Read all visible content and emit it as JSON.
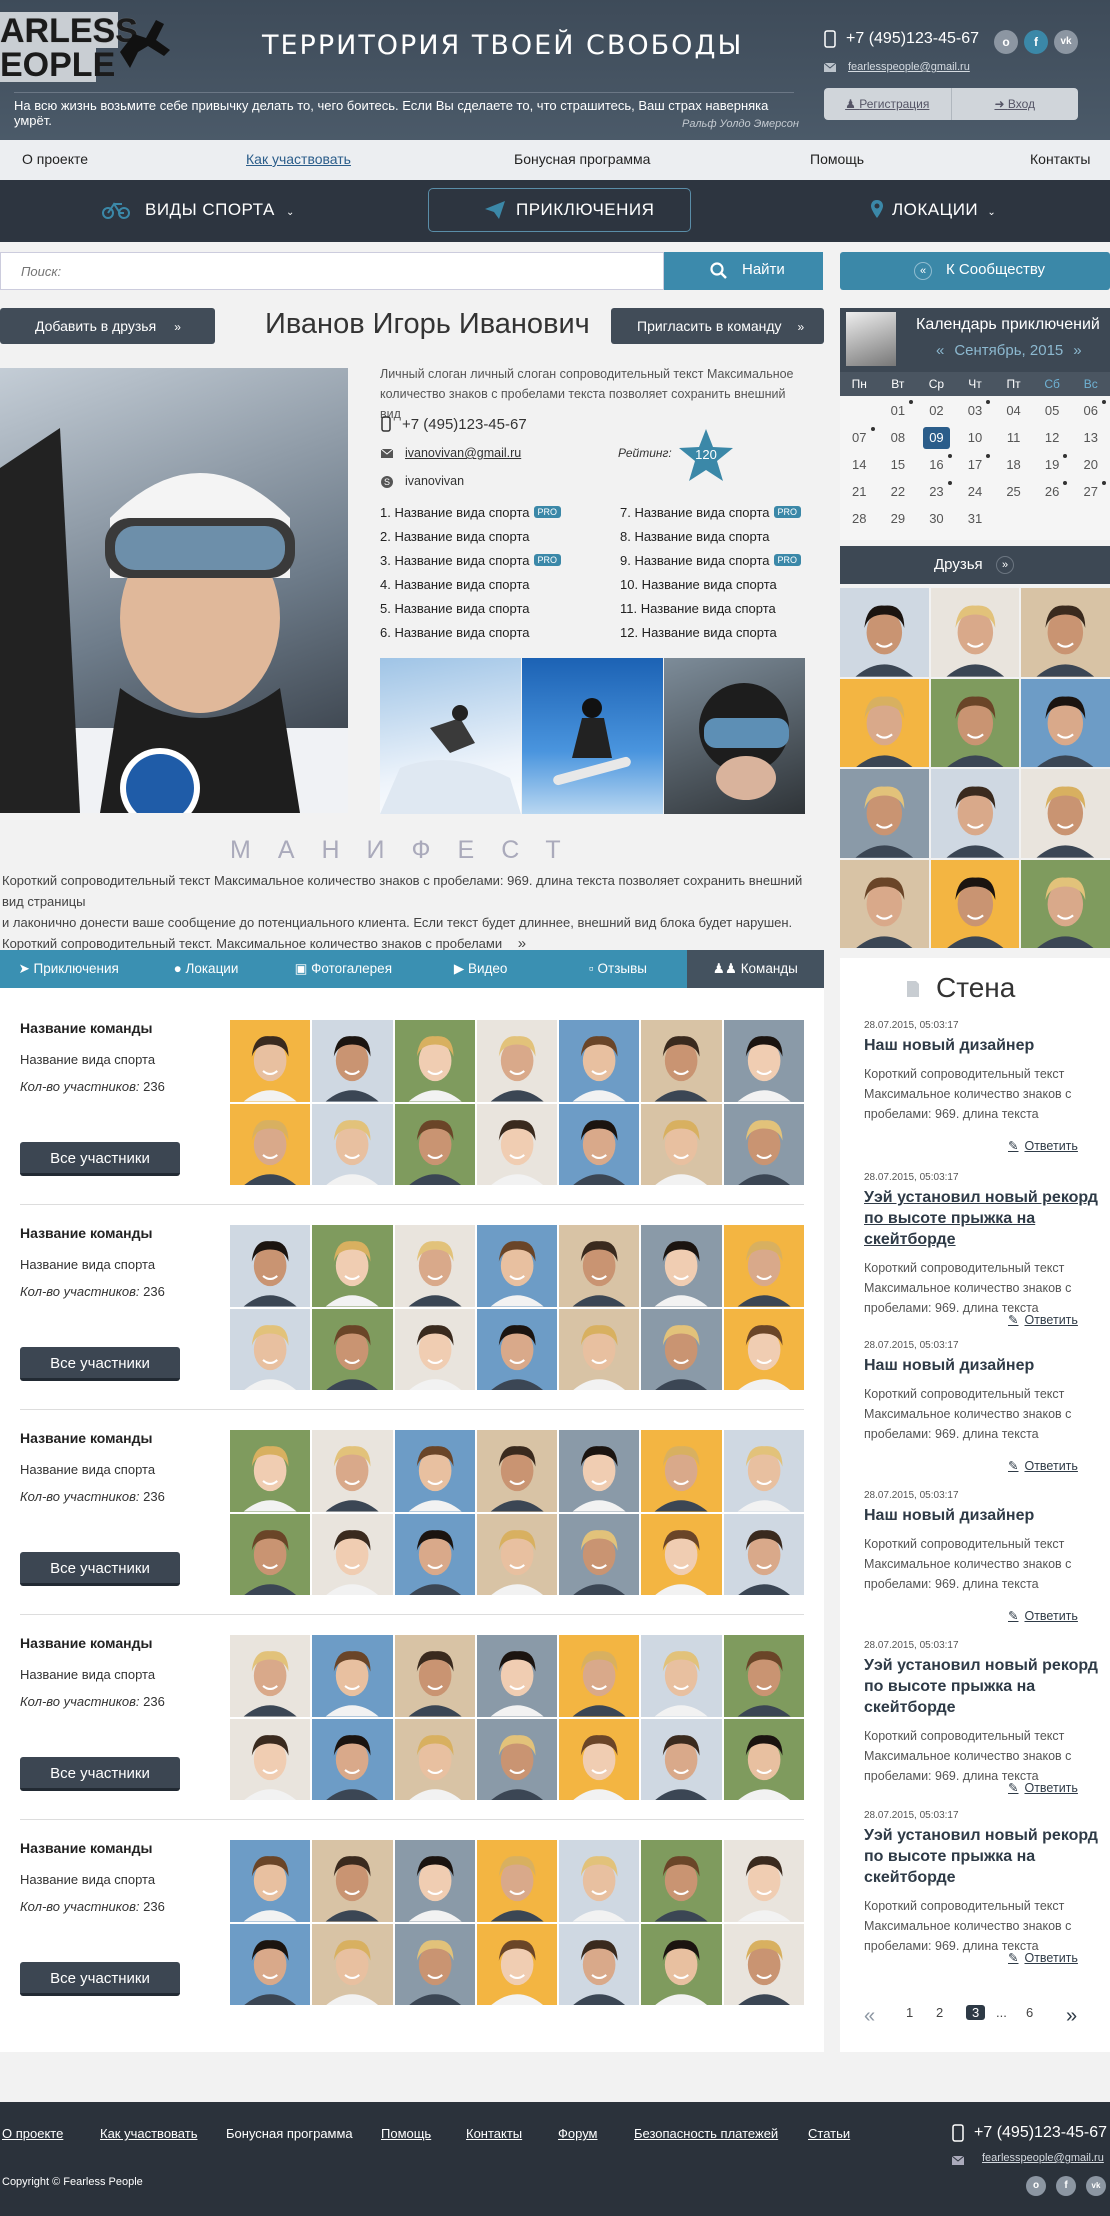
{
  "header": {
    "logo_line1": "ARLESS",
    "logo_line2": "EOPLE",
    "slogan": "ТЕРРИТОРИЯ ТВОЕЙ СВОБОДЫ",
    "quote": "На всю жизнь возьмите себе привычку делать то, чего боитесь. Если Вы сделаете то, что страшитесь, Ваш страх наверняка умрёт.",
    "quote_author": "Ральф Уолдо Эмерсон",
    "phone": "+7 (495)123-45-67",
    "email": "fearlesspeople@gmail.ru",
    "register": "Регистрация",
    "login": "Вход",
    "social": [
      "о",
      "f",
      "vk"
    ]
  },
  "top_nav": [
    "О проекте",
    "Как участвовать",
    "Бонусная программа",
    "Помощь",
    "Контакты"
  ],
  "main_nav": {
    "sports": "ВИДЫ СПОРТА",
    "adventures": "ПРИКЛЮЧЕНИЯ",
    "locations": "ЛОКАЦИИ"
  },
  "search": {
    "placeholder": "Поиск:",
    "button": "Найти"
  },
  "community_button": "К Сообществу",
  "profile": {
    "add_friend": "Добавить в друзья",
    "name": "Иванов Игорь Иванович",
    "invite": "Пригласить в команду",
    "slogan": "Личный слоган личный слоган сопроводительный текст Максимальное количество знаков с пробелами текста позволяет сохранить внешний вид",
    "phone": "+7 (495)123-45-67",
    "email": "ivanovivan@gmail.ru",
    "skype": "ivanovivan",
    "rating_label": "Рейтинг:",
    "rating": "120",
    "pro_badge": "PRO",
    "sports_left": [
      {
        "n": "1. Название вида спорта",
        "pro": true
      },
      {
        "n": "2. Название вида спорта",
        "pro": false
      },
      {
        "n": "3. Название вида спорта",
        "pro": true
      },
      {
        "n": "4. Название вида спорта",
        "pro": false
      },
      {
        "n": "5. Название вида спорта",
        "pro": false
      },
      {
        "n": "6. Название вида спорта",
        "pro": false
      }
    ],
    "sports_right": [
      {
        "n": "7. Название вида спорта",
        "pro": true
      },
      {
        "n": "8. Название вида спорта",
        "pro": false
      },
      {
        "n": "9. Название вида спорта",
        "pro": true
      },
      {
        "n": "10. Название вида спорта",
        "pro": false
      },
      {
        "n": "11. Название вида спорта",
        "pro": false
      },
      {
        "n": "12. Название вида спорта",
        "pro": false
      }
    ]
  },
  "manifest": {
    "title": "МАНИФЕСТ",
    "text1": "Короткий сопроводительный текст Максимальное количество знаков с пробелами: 969. длина текста позволяет сохранить внешний вид страницы",
    "text2": "и лаконично донести ваше сообщение до потенциального клиента. Если текст будет длиннее, внешний вид блока будет нарушен.",
    "text3": "Короткий сопроводительный текст. Максимальное количество знаков с пробелами"
  },
  "tabs": [
    "Приключения",
    "Локации",
    "Фотогалерея",
    "Видео",
    "Отзывы",
    "Команды"
  ],
  "teams": [
    {
      "name": "Название команды",
      "sport": "Название вида спорта",
      "count_label": "Кол-во участников:",
      "count": "236",
      "button": "Все участники"
    },
    {
      "name": "Название команды",
      "sport": "Название вида спорта",
      "count_label": "Кол-во участников:",
      "count": "236",
      "button": "Все участники"
    },
    {
      "name": "Название команды",
      "sport": "Название вида спорта",
      "count_label": "Кол-во участников:",
      "count": "236",
      "button": "Все участники"
    },
    {
      "name": "Название команды",
      "sport": "Название вида спорта",
      "count_label": "Кол-во участников:",
      "count": "236",
      "button": "Все участники"
    },
    {
      "name": "Название команды",
      "sport": "Название вида спорта",
      "count_label": "Кол-во участников:",
      "count": "236",
      "button": "Все участники"
    }
  ],
  "calendar": {
    "title": "Календарь приключений",
    "month": "Сентябрь, 2015",
    "weekdays": [
      "Пн",
      "Вт",
      "Ср",
      "Чт",
      "Пт",
      "Сб",
      "Вс"
    ],
    "days": [
      "",
      "01",
      "02",
      "03",
      "04",
      "05",
      "06",
      "07",
      "08",
      "09",
      "10",
      "11",
      "12",
      "13",
      "14",
      "15",
      "16",
      "17",
      "18",
      "19",
      "20",
      "21",
      "22",
      "23",
      "24",
      "25",
      "26",
      "27",
      "28",
      "29",
      "30",
      "31",
      "",
      "",
      ""
    ],
    "event_days": [
      "01",
      "03",
      "06",
      "07",
      "16",
      "17",
      "19",
      "23",
      "26",
      "27"
    ],
    "today": "09"
  },
  "friends_title": "Друзья",
  "wall": {
    "title": "Стена",
    "reply": "Ответить",
    "posts": [
      {
        "date": "28.07.2015, 05:03:17",
        "title": "Наш новый дизайнер",
        "text": "Короткий сопроводительный текст Максимальное количество знаков с пробелами: 969. длина текста"
      },
      {
        "date": "28.07.2015, 05:03:17",
        "title": "Уэй установил новый рекорд по высоте прыжка на скейтборде",
        "text": "Короткий сопроводительный текст Максимальное количество знаков с пробелами: 969. длина текста"
      },
      {
        "date": "28.07.2015, 05:03:17",
        "title": "Наш новый дизайнер",
        "text": "Короткий сопроводительный текст Максимальное количество знаков с пробелами: 969. длина текста"
      },
      {
        "date": "28.07.2015, 05:03:17",
        "title": "Наш новый дизайнер",
        "text": "Короткий сопроводительный текст Максимальное количество знаков с пробелами: 969. длина текста"
      },
      {
        "date": "28.07.2015, 05:03:17",
        "title": "Уэй установил новый рекорд по высоте прыжка на скейтборде",
        "text": "Короткий сопроводительный текст Максимальное количество знаков с пробелами: 969. длина текста"
      },
      {
        "date": "28.07.2015, 05:03:17",
        "title": "Уэй установил новый рекорд по высоте прыжка на скейтборде",
        "text": "Короткий сопроводительный текст Максимальное количество знаков с пробелами: 969. длина текста"
      }
    ],
    "pages": [
      "1",
      "2",
      "3",
      "...",
      "6"
    ],
    "current_page": "3"
  },
  "footer": {
    "links": [
      "О проекте",
      "Как участвовать",
      "Бонусная программа",
      "Помощь",
      "Контакты",
      "Форум",
      "Безопасность платежей",
      "Статьи"
    ],
    "phone": "+7 (495)123-45-67",
    "email": "fearlesspeople@gmail.ru",
    "copyright": "Copyright © Fearless People"
  },
  "colors": {
    "accent": "#3b88a8",
    "dark": "#2d3540",
    "header": "#435160"
  }
}
